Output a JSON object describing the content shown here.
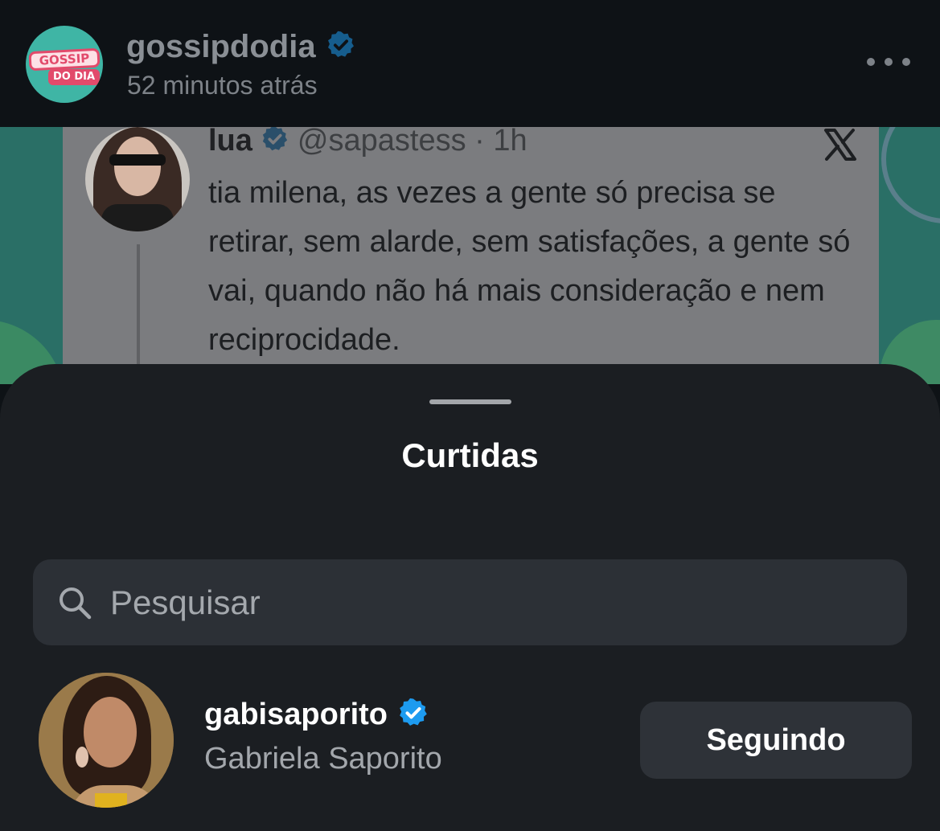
{
  "post": {
    "author": "gossipdodia",
    "time": "52 minutos atrás",
    "avatar_text_top": "GOSSIP",
    "avatar_text_bottom": "DO DIA"
  },
  "tweet": {
    "name": "lua",
    "handle": "@sapastess · 1h",
    "text": "tia milena, as vezes a gente só precisa se retirar, sem alarde, sem satisfações, a gente só vai, quando não há mais consideração e nem reciprocidade."
  },
  "sheet": {
    "title": "Curtidas",
    "search": {
      "placeholder": "Pesquisar",
      "value": ""
    },
    "users": [
      {
        "username": "gabisaporito",
        "full_name": "Gabriela Saporito",
        "verified": true,
        "button_label": "Seguindo"
      }
    ]
  },
  "colors": {
    "background": "#0e1216",
    "sheet": "#1b1e22",
    "verified_badge": "#1d9bf0",
    "button": "#2e3238"
  },
  "icons": [
    "verified-icon",
    "more-icon",
    "x-logo-icon",
    "search-icon"
  ]
}
